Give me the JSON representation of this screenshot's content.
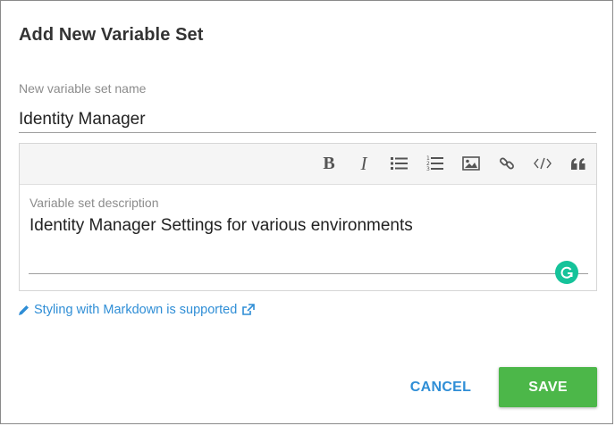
{
  "dialog": {
    "title": "Add New Variable Set"
  },
  "name_field": {
    "label": "New variable set name",
    "value": "Identity Manager"
  },
  "editor": {
    "toolbar": [
      {
        "name": "bold-icon",
        "glyph": "B"
      },
      {
        "name": "italic-icon",
        "glyph": "I"
      },
      {
        "name": "bulleted-list-icon"
      },
      {
        "name": "numbered-list-icon"
      },
      {
        "name": "image-icon"
      },
      {
        "name": "link-icon"
      },
      {
        "name": "code-icon"
      },
      {
        "name": "quote-icon"
      }
    ],
    "description_label": "Variable set description",
    "description_value": "Identity Manager Settings for various environments"
  },
  "markdown_hint": {
    "text": "Styling with Markdown is supported"
  },
  "actions": {
    "cancel_label": "CANCEL",
    "save_label": "SAVE"
  },
  "colors": {
    "accent_link": "#2f8ed6",
    "save_button": "#4cb749",
    "grammarly": "#15c39a"
  }
}
